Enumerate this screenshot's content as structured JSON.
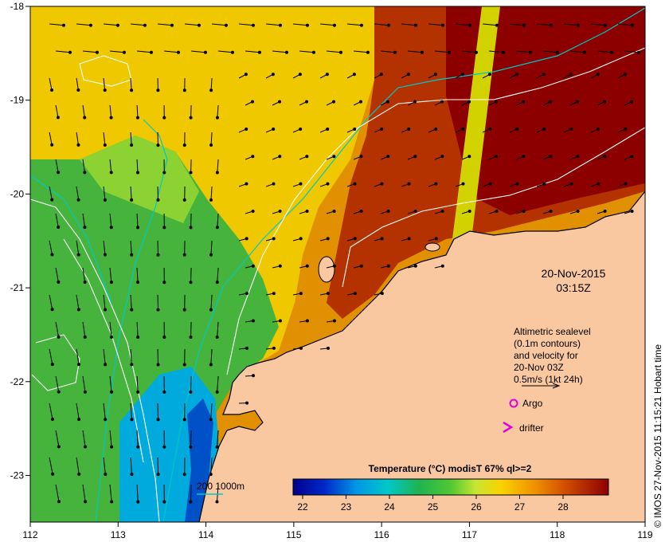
{
  "map": {
    "datetime_line1": "20-Nov-2015",
    "datetime_line2": "03:15Z",
    "legend_lines": [
      "Altimetric sealevel",
      "(0.1m contours)",
      "and velocity for",
      "20-Nov 03Z",
      "0.5m/s (1kt 24h)"
    ],
    "argo_label": "Argo",
    "drifter_label": "drifter",
    "isobath_label": "200  1000m",
    "credit": "© IMOS 27-Nov-2015 11:15:21 Hobart time",
    "x_ticks": [
      "112",
      "113",
      "114",
      "115",
      "116",
      "117",
      "118",
      "119"
    ],
    "y_ticks": [
      "-18",
      "-19",
      "-20",
      "-21",
      "-22",
      "-23"
    ],
    "colorbar_title": "Temperature (°C) modisT 67% ql>=2",
    "colorbar_ticks": [
      "22",
      "23",
      "24",
      "25",
      "26",
      "27",
      "28"
    ],
    "colors": {
      "land": "#fac8a0",
      "isobath": "#00c8c8",
      "contour": "#ffffff",
      "argo": "#e000e0",
      "drifter": "#e000e0"
    }
  }
}
